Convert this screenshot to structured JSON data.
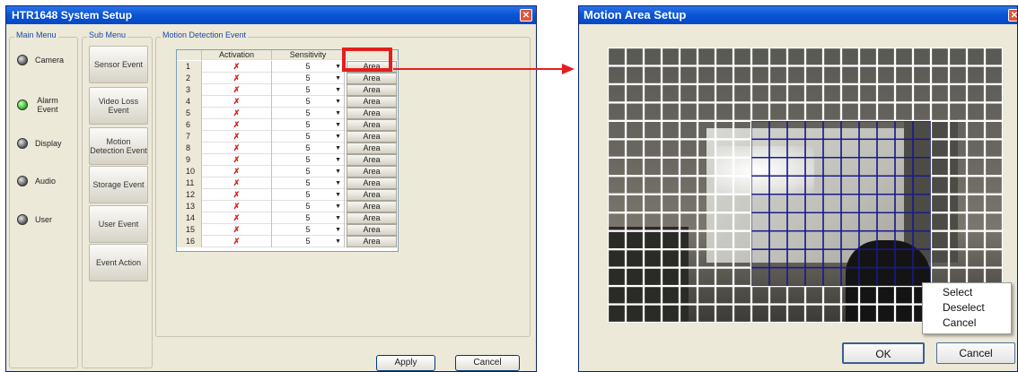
{
  "system_setup": {
    "title": "HTR1648 System Setup",
    "close_icon": "close-icon",
    "main_menu": {
      "label": "Main Menu",
      "items": [
        {
          "label": "Camera",
          "active": false
        },
        {
          "label": "Alarm Event",
          "active": true
        },
        {
          "label": "Display",
          "active": false
        },
        {
          "label": "Audio",
          "active": false
        },
        {
          "label": "User",
          "active": false
        }
      ]
    },
    "sub_menu": {
      "label": "Sub Menu",
      "items": [
        "Sensor Event",
        "Video Loss Event",
        "Motion Detection Event",
        "Storage Event",
        "User Event",
        "Event Action"
      ]
    },
    "motion_detection": {
      "label": "Motion Detection Event",
      "columns": [
        "Activation",
        "Sensitivity"
      ],
      "rows": [
        {
          "num": "1",
          "check": "✗",
          "sensitivity": "5",
          "area": "Area"
        },
        {
          "num": "2",
          "check": "✗",
          "sensitivity": "5",
          "area": "Area"
        },
        {
          "num": "3",
          "check": "✗",
          "sensitivity": "5",
          "area": "Area"
        },
        {
          "num": "4",
          "check": "✗",
          "sensitivity": "5",
          "area": "Area"
        },
        {
          "num": "5",
          "check": "✗",
          "sensitivity": "5",
          "area": "Area"
        },
        {
          "num": "6",
          "check": "✗",
          "sensitivity": "5",
          "area": "Area"
        },
        {
          "num": "7",
          "check": "✗",
          "sensitivity": "5",
          "area": "Area"
        },
        {
          "num": "8",
          "check": "✗",
          "sensitivity": "5",
          "area": "Area"
        },
        {
          "num": "9",
          "check": "✗",
          "sensitivity": "5",
          "area": "Area"
        },
        {
          "num": "10",
          "check": "✗",
          "sensitivity": "5",
          "area": "Area"
        },
        {
          "num": "11",
          "check": "✗",
          "sensitivity": "5",
          "area": "Area"
        },
        {
          "num": "12",
          "check": "✗",
          "sensitivity": "5",
          "area": "Area"
        },
        {
          "num": "13",
          "check": "✗",
          "sensitivity": "5",
          "area": "Area"
        },
        {
          "num": "14",
          "check": "✗",
          "sensitivity": "5",
          "area": "Area"
        },
        {
          "num": "15",
          "check": "✗",
          "sensitivity": "5",
          "area": "Area"
        },
        {
          "num": "16",
          "check": "✗",
          "sensitivity": "5",
          "area": "Area"
        }
      ]
    },
    "apply_label": "Apply",
    "cancel_label": "Cancel"
  },
  "motion_area": {
    "title": "Motion Area Setup",
    "close_icon": "close-icon",
    "grid_cols": 22,
    "grid_rows": 15,
    "context_menu": [
      "Select",
      "Deselect",
      "Cancel"
    ],
    "ok_label": "OK",
    "cancel_label": "Cancel"
  },
  "colors": {
    "highlight": "#e41e1e",
    "arrow": "#e41e1e",
    "selected_cell": "#1a1a8c",
    "grid_line": "#ffffff"
  }
}
